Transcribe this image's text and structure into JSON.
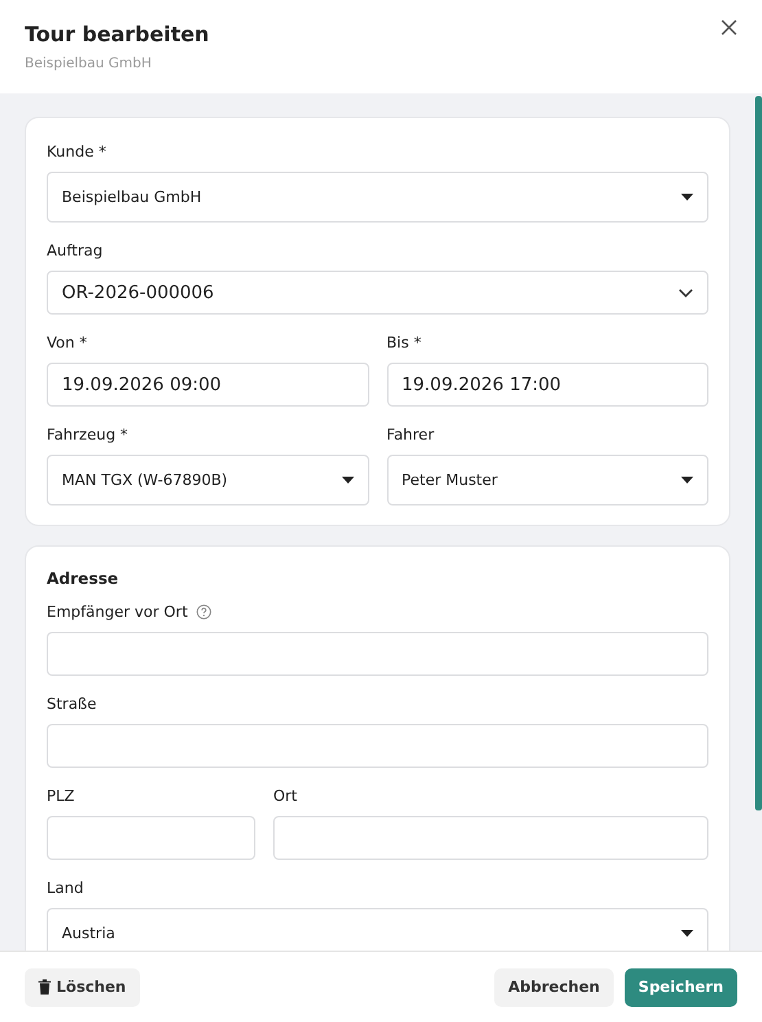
{
  "dialog": {
    "title": "Tour bearbeiten",
    "subtitle": "Beispielbau GmbH"
  },
  "sections": [
    {
      "rows": [
        [
          {
            "label": "Kunde *",
            "kind": "select",
            "value": "Beispielbau GmbH",
            "help": false
          }
        ],
        [
          {
            "label": "Auftrag",
            "kind": "combobox",
            "value": "OR-2026-000006",
            "help": false
          }
        ],
        [
          {
            "label": "Von *",
            "kind": "input",
            "value": "19.09.2026 09:00",
            "help": false
          },
          {
            "label": "Bis *",
            "kind": "input",
            "value": "19.09.2026 17:00",
            "help": false
          }
        ],
        [
          {
            "label": "Fahrzeug *",
            "kind": "select",
            "value": "MAN TGX (W-67890B)",
            "help": false
          },
          {
            "label": "Fahrer",
            "kind": "select",
            "value": "Peter Muster",
            "help": false
          }
        ]
      ]
    },
    {
      "heading": "Adresse",
      "rows": [
        [
          {
            "label": "Empfänger vor Ort",
            "kind": "input",
            "help": true
          }
        ],
        [
          {
            "label": "Straße",
            "kind": "input",
            "help": false
          }
        ],
        [
          {
            "label": "PLZ",
            "kind": "postcode",
            "help": false
          },
          {
            "label": "Ort",
            "kind": "input",
            "help": false
          }
        ],
        [
          {
            "label": "Land",
            "kind": "select",
            "value": "Austria",
            "help": false
          }
        ]
      ]
    }
  ],
  "footer": {
    "delete": "Löschen",
    "cancel": "Abbrechen",
    "save": "Speichern"
  }
}
